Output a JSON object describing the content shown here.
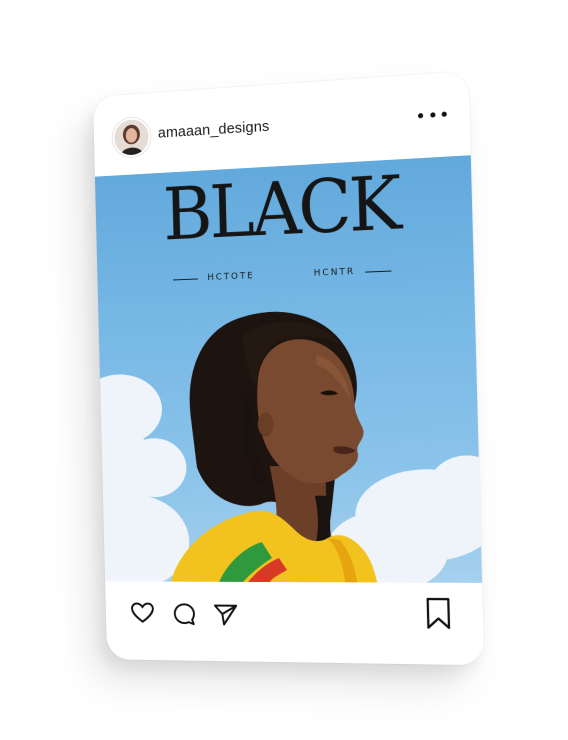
{
  "post": {
    "username": "amaaan_designs",
    "avatar_icon": "user-avatar",
    "menu_icon": "more-options-icon"
  },
  "cover": {
    "title": "BLACK",
    "subtitle_left": "HCTOTE",
    "subtitle_right": "HCNTR",
    "sky_color": "#78b9e6"
  },
  "actions": {
    "like_icon": "heart-icon",
    "comment_icon": "comment-icon",
    "share_icon": "send-icon",
    "save_icon": "bookmark-icon"
  }
}
